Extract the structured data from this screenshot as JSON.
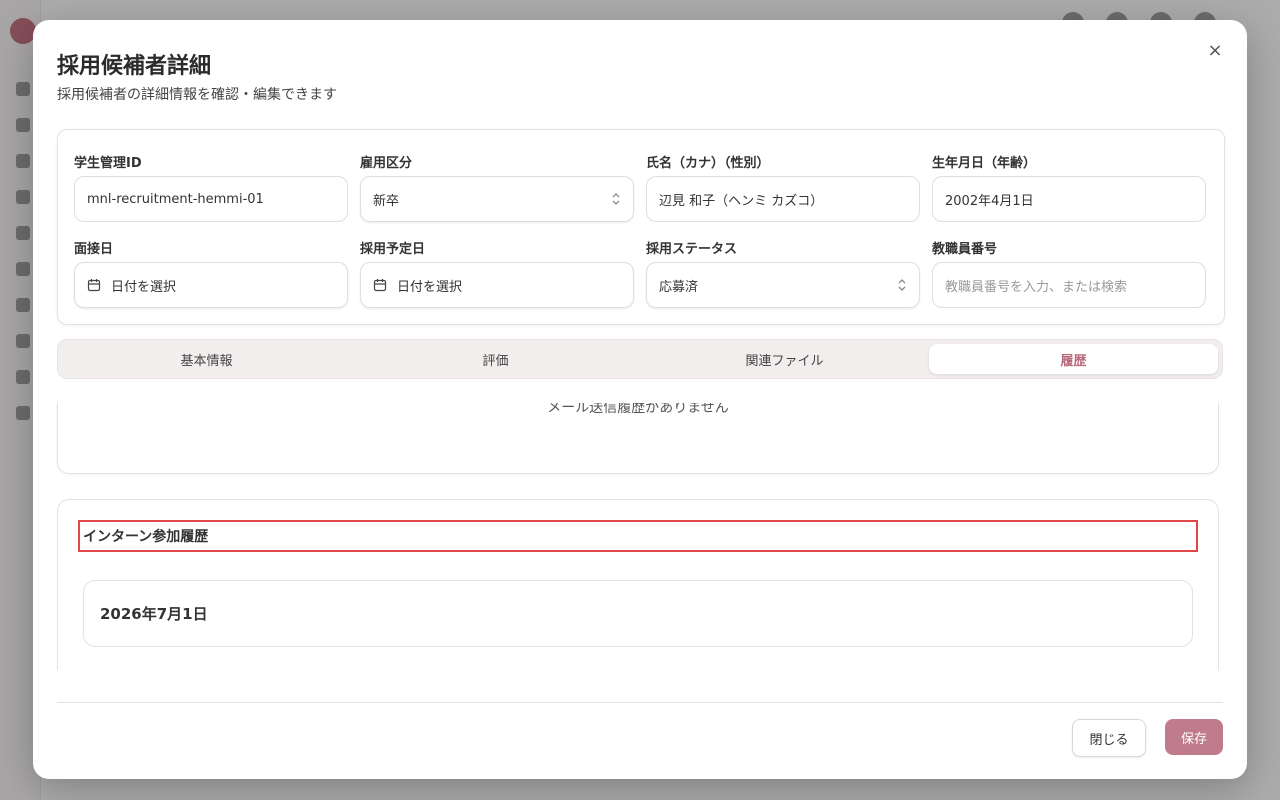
{
  "modal": {
    "title": "採用候補者詳細",
    "description": "採用候補者の詳細情報を確認・編集できます",
    "close_symbol": "×"
  },
  "form": {
    "student_id": {
      "label": "学生管理ID",
      "value": "mnl-recruitment-hemmi-01"
    },
    "employment_type": {
      "label": "雇用区分",
      "value": "新卒"
    },
    "name": {
      "label": "氏名（カナ）（性別）",
      "value": "辺見 和子（ヘンミ カズコ）"
    },
    "birthdate": {
      "label": "生年月日（年齢）",
      "value": "2002年4月1日"
    },
    "interview_date": {
      "label": "面接日",
      "placeholder": "日付を選択"
    },
    "planned_hire_date": {
      "label": "採用予定日",
      "placeholder": "日付を選択"
    },
    "hiring_status": {
      "label": "採用ステータス",
      "value": "応募済"
    },
    "staff_number": {
      "label": "教職員番号",
      "placeholder": "教職員番号を入力、または検索"
    }
  },
  "tabs": [
    {
      "label": "基本情報"
    },
    {
      "label": "評価"
    },
    {
      "label": "関連ファイル"
    },
    {
      "label": "履歴"
    }
  ],
  "active_tab": "履歴",
  "mail_history": {
    "empty_text": "メール送信履歴がありません"
  },
  "intern_history": {
    "title": "インターン参加履歴",
    "items": [
      "2026年7月1日"
    ]
  },
  "footer": {
    "close_label": "閉じる",
    "save_label": "保存"
  },
  "colors": {
    "accent": "#c07c8a",
    "highlight_border": "#e04848"
  }
}
